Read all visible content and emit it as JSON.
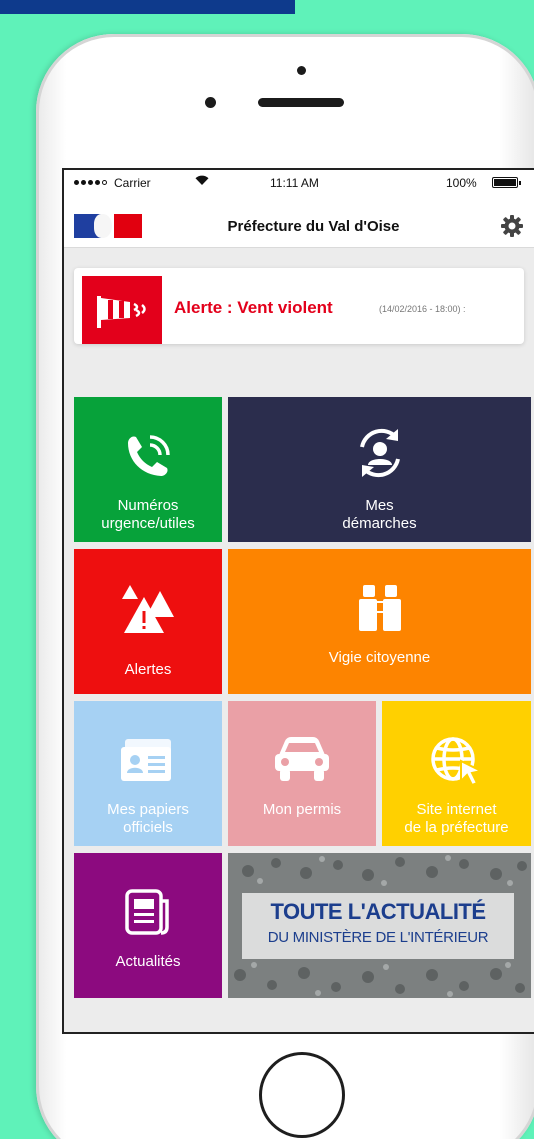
{
  "status_bar": {
    "carrier": "Carrier",
    "time": "11:11 AM",
    "battery": "100%"
  },
  "header": {
    "title": "Préfecture du Val d'Oise"
  },
  "alert": {
    "title": "Alerte : Vent violent",
    "date": "(14/02/2016 - 18:00) :"
  },
  "tiles": {
    "numeros": {
      "label_1": "Numéros",
      "label_2": "urgence/utiles"
    },
    "demarches": {
      "label_1": "Mes",
      "label_2": "démarches"
    },
    "alertes": {
      "label": "Alertes"
    },
    "vigie": {
      "label": "Vigie citoyenne"
    },
    "papiers": {
      "label_1": "Mes papiers",
      "label_2": "officiels"
    },
    "permis": {
      "label": "Mon permis"
    },
    "site": {
      "label_1": "Site internet",
      "label_2": "de la préfecture"
    },
    "actualites": {
      "label": "Actualités"
    }
  },
  "news_banner": {
    "line_1": "TOUTE L'ACTUALITÉ",
    "line_2": "DU MINISTÈRE DE L'INTÉRIEUR"
  },
  "colors": {
    "background": "#5ff2b9",
    "green": "#07a23a",
    "navy": "#2b2d4d",
    "red": "#ee0f0f",
    "orange": "#fd8400",
    "light_blue": "#a6d1f3",
    "pink": "#eaa0a6",
    "yellow": "#ffd000",
    "purple": "#8c0a7f"
  },
  "icons": [
    "phone-icon",
    "user-sync-icon",
    "warning-triangles-icon",
    "binoculars-icon",
    "id-card-icon",
    "car-icon",
    "globe-cursor-icon",
    "newspaper-icon",
    "windsock-icon",
    "gear-icon",
    "wifi-icon"
  ]
}
